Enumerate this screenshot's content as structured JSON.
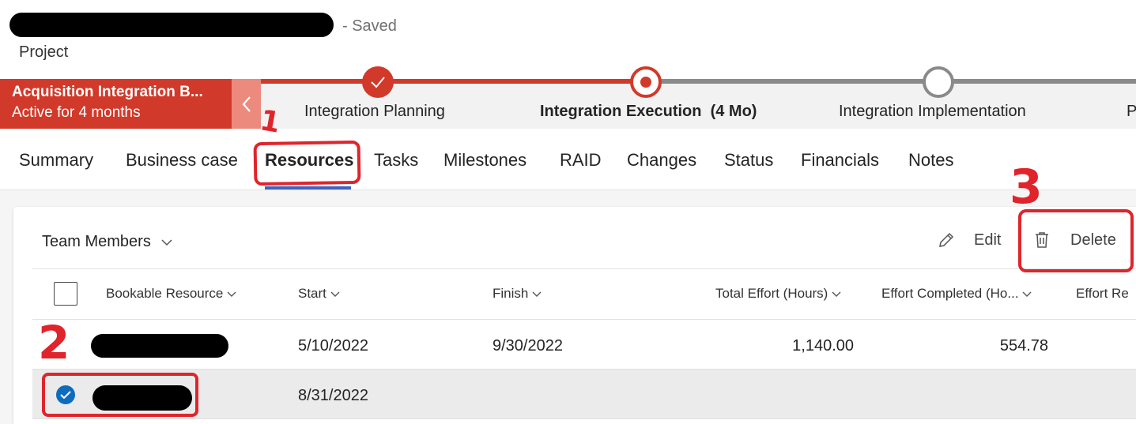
{
  "header": {
    "saved_status": "- Saved",
    "entity_type": "Project"
  },
  "bpf": {
    "active_stage_name": "Acquisition Integration B...",
    "active_duration": "Active for 4 months",
    "stages": [
      {
        "label": "Integration Planning",
        "state": "completed"
      },
      {
        "label": "Integration Execution",
        "duration": "(4 Mo)",
        "state": "active"
      },
      {
        "label": "Integration Implementation",
        "state": "pending"
      },
      {
        "label": "P",
        "state": "pending"
      }
    ]
  },
  "tabs": [
    "Summary",
    "Business case",
    "Resources",
    "Tasks",
    "Milestones",
    "RAID",
    "Changes",
    "Status",
    "Financials",
    "Notes"
  ],
  "active_tab": "Resources",
  "subgrid": {
    "title": "Team Members",
    "edit_label": "Edit",
    "delete_label": "Delete",
    "columns": [
      "Bookable Resource",
      "Start",
      "Finish",
      "Total Effort (Hours)",
      "Effort Completed (Ho...",
      "Effort Re"
    ],
    "rows": [
      {
        "selected": false,
        "start": "5/10/2022",
        "finish": "9/30/2022",
        "total_effort": "1,140.00",
        "effort_completed": "554.78"
      },
      {
        "selected": true,
        "start": "8/31/2022",
        "finish": "",
        "total_effort": "",
        "effort_completed": ""
      }
    ]
  },
  "annotations": [
    "1",
    "2",
    "3"
  ],
  "colors": {
    "brand_red": "#d13a2a",
    "annotation_red": "#e0242b",
    "selection_blue": "#0f6cbd",
    "tab_underline": "#3f63c0"
  },
  "icons": {
    "collapse": "chevron-left-icon",
    "completed_stage": "checkmark-icon",
    "edit": "pencil-icon",
    "delete": "trash-icon",
    "sort": "chevron-down-icon"
  }
}
